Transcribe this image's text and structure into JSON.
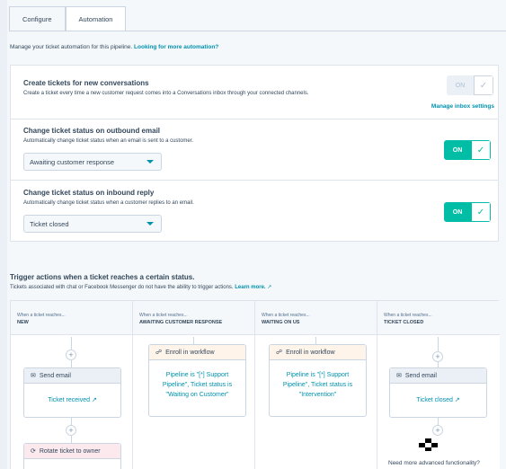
{
  "tabs": [
    {
      "label": "Configure"
    },
    {
      "label": "Automation"
    }
  ],
  "intro": {
    "text": "Manage your ticket automation for this pipeline.",
    "link": "Looking for more automation?"
  },
  "sections": [
    {
      "title": "Create tickets for new conversations",
      "description": "Create a ticket every time a new customer request comes into a Conversations inbox through your connected channels.",
      "toggle": "ON",
      "toggle_state": "disabled",
      "link": "Manage inbox settings"
    },
    {
      "title": "Change ticket status on outbound email",
      "description": "Automatically change ticket status when an email is sent to a customer.",
      "select": "Awaiting customer response",
      "toggle": "ON",
      "toggle_state": "on"
    },
    {
      "title": "Change ticket status on inbound reply",
      "description": "Automatically change ticket status when a customer replies to an email.",
      "select": "Ticket closed",
      "toggle": "ON",
      "toggle_state": "on"
    }
  ],
  "trigger": {
    "title": "Trigger actions when a ticket reaches a certain status.",
    "description": "Tickets associated with chat or Facebook Messenger do not have the ability to trigger actions.",
    "link": "Learn more."
  },
  "columns": [
    {
      "when": "When a ticket reaches...",
      "stage": "NEW",
      "cards": [
        {
          "icon": "email-icon",
          "title": "Send email",
          "body": "Ticket received ↗"
        },
        {
          "icon": "rotate-icon",
          "title": "Rotate ticket to owner",
          "body": ""
        }
      ]
    },
    {
      "when": "When a ticket reaches...",
      "stage": "AWAITING CUSTOMER RESPONSE",
      "cards": [
        {
          "icon": "workflow-icon",
          "title": "Enroll in workflow",
          "body": "Pipeline is \"[*] Support Pipeline\", Ticket status is \"Waiting on Customer\""
        }
      ]
    },
    {
      "when": "When a ticket reaches...",
      "stage": "WAITING ON US",
      "cards": [
        {
          "icon": "workflow-icon",
          "title": "Enroll in workflow",
          "body": "Pipeline is \"[*] Support Pipeline\", Ticket status is \"Intervention\""
        }
      ]
    },
    {
      "when": "When a ticket reaches...",
      "stage": "TICKET CLOSED",
      "cards": [
        {
          "icon": "email-icon",
          "title": "Send email",
          "body": "Ticket closed ↗"
        }
      ]
    }
  ],
  "footer": {
    "need_more": "Need more advanced functionality?"
  },
  "colors": {
    "accent": "#00bda5",
    "link": "#0091ae",
    "text": "#33475b"
  }
}
